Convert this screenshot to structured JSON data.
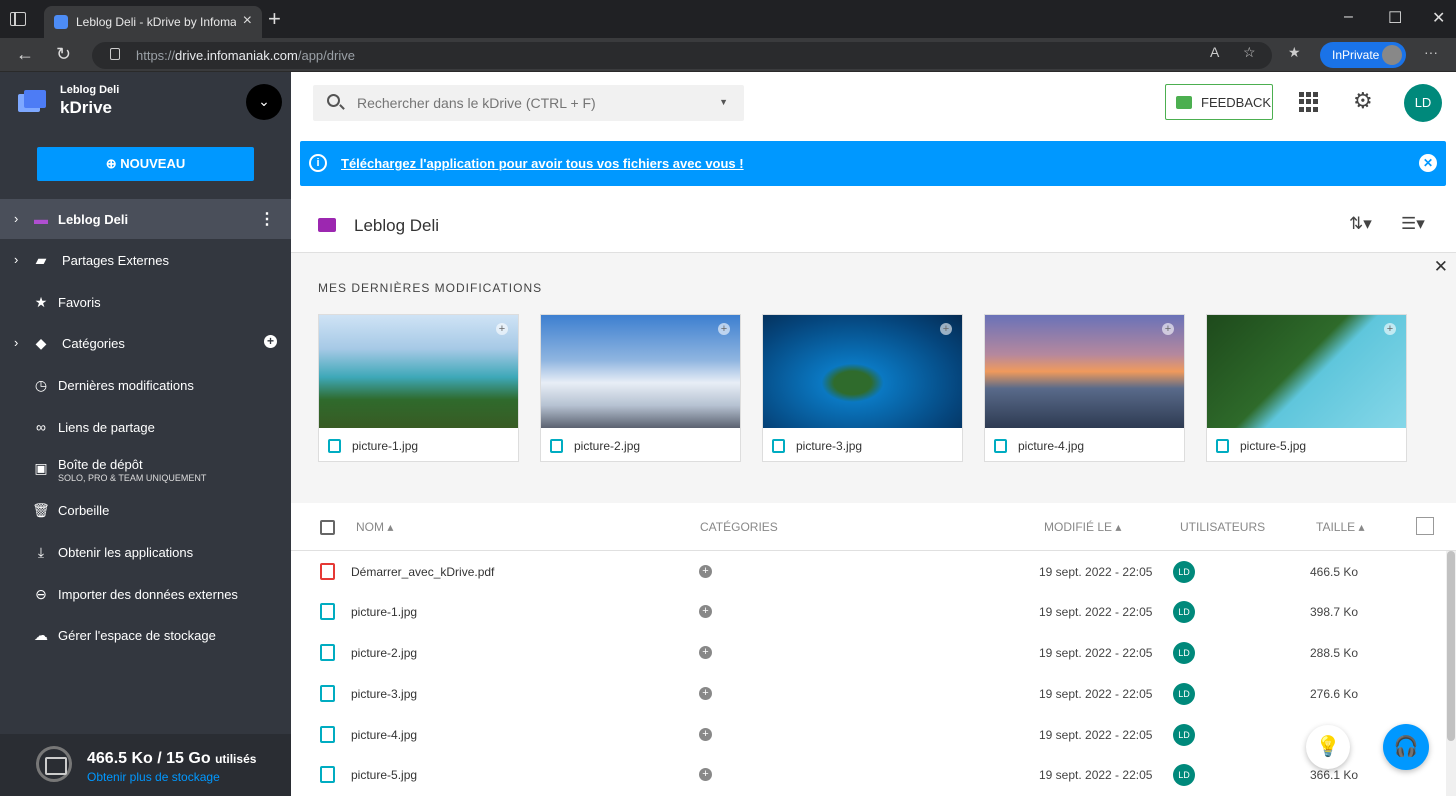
{
  "browser": {
    "tab_title": "Leblog Deli - kDrive by Infomaniak",
    "url_prefix": "https://",
    "url_host": "drive.infomaniak.com",
    "url_path": "/app/drive",
    "inprivate_label": "InPrivate"
  },
  "sidebar": {
    "drive_owner": "Leblog Deli",
    "app_name": "kDrive",
    "new_button": "NOUVEAU",
    "items": [
      {
        "label": "Leblog Deli",
        "icon": "drive-icon"
      },
      {
        "label": "Partages Externes",
        "icon": "shared-folder-icon"
      },
      {
        "label": "Favoris",
        "icon": "star-icon"
      },
      {
        "label": "Catégories",
        "icon": "tag-icon"
      },
      {
        "label": "Dernières modifications",
        "icon": "clock-icon"
      },
      {
        "label": "Liens de partage",
        "icon": "link-icon"
      },
      {
        "label": "Boîte de dépôt",
        "sub": "SOLO, PRO & TEAM UNIQUEMENT",
        "icon": "dropbox-icon"
      },
      {
        "label": "Corbeille",
        "icon": "trash-icon"
      },
      {
        "label": "Obtenir les applications",
        "icon": "download-icon"
      },
      {
        "label": "Importer des données externes",
        "icon": "import-icon"
      },
      {
        "label": "Gérer l'espace de stockage",
        "icon": "storage-icon"
      }
    ],
    "storage": {
      "used": "466.5 Ko / 15 Go",
      "used_suffix": "utilisés",
      "more_link": "Obtenir plus de stockage"
    }
  },
  "topbar": {
    "search_placeholder": "Rechercher dans le kDrive (CTRL + F)",
    "feedback_label": "FEEDBACK",
    "avatar_initials": "LD"
  },
  "banner": {
    "message": "Téléchargez l'application pour avoir tous vos fichiers avec vous !"
  },
  "folder": {
    "name": "Leblog Deli"
  },
  "recent": {
    "heading": "MES DERNIÈRES MODIFICATIONS",
    "cards": [
      {
        "name": "picture-1.jpg"
      },
      {
        "name": "picture-2.jpg"
      },
      {
        "name": "picture-3.jpg"
      },
      {
        "name": "picture-4.jpg"
      },
      {
        "name": "picture-5.jpg"
      }
    ]
  },
  "table": {
    "headers": {
      "name": "NOM",
      "categories": "CATÉGORIES",
      "modified": "MODIFIÉ LE",
      "users": "UTILISATEURS",
      "size": "TAILLE"
    },
    "rows": [
      {
        "name": "Démarrer_avec_kDrive.pdf",
        "date": "19 sept. 2022 - 22:05",
        "user": "LD",
        "size": "466.5 Ko",
        "type": "pdf"
      },
      {
        "name": "picture-1.jpg",
        "date": "19 sept. 2022 - 22:05",
        "user": "LD",
        "size": "398.7 Ko",
        "type": "image"
      },
      {
        "name": "picture-2.jpg",
        "date": "19 sept. 2022 - 22:05",
        "user": "LD",
        "size": "288.5 Ko",
        "type": "image"
      },
      {
        "name": "picture-3.jpg",
        "date": "19 sept. 2022 - 22:05",
        "user": "LD",
        "size": "276.6 Ko",
        "type": "image"
      },
      {
        "name": "picture-4.jpg",
        "date": "19 sept. 2022 - 22:05",
        "user": "LD",
        "size": "",
        "type": "image"
      },
      {
        "name": "picture-5.jpg",
        "date": "19 sept. 2022 - 22:05",
        "user": "LD",
        "size": "366.1 Ko",
        "type": "image"
      }
    ]
  },
  "colors": {
    "sidebar_bg": "#33373f",
    "accent_blue": "#0098ff",
    "avatar_teal": "#00897b",
    "feedback_green": "#4caf50",
    "drive_purple": "#9c27b0"
  }
}
